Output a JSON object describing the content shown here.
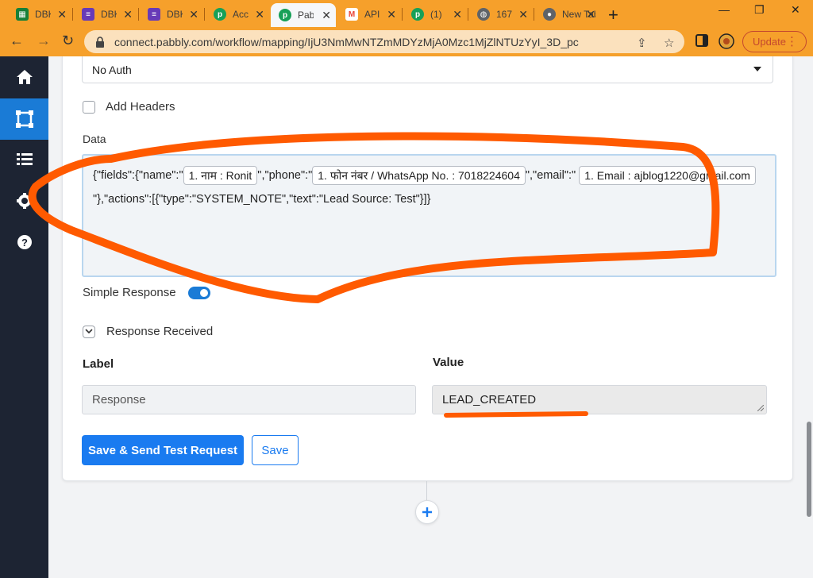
{
  "browser": {
    "tabs": [
      {
        "label": "DBK",
        "icon": "sheets-icon",
        "color": "#188038"
      },
      {
        "label": "DBK",
        "icon": "forms-icon",
        "color": "#673ab7"
      },
      {
        "label": "DBK",
        "icon": "forms-icon",
        "color": "#673ab7"
      },
      {
        "label": "Acc",
        "icon": "pabbly-icon",
        "color": "#17a058"
      },
      {
        "label": "Pab",
        "icon": "pabbly-icon",
        "color": "#17a058"
      },
      {
        "label": "API",
        "icon": "gmail-icon",
        "color": "#ea4335"
      },
      {
        "label": "(1)",
        "icon": "pabbly-icon",
        "color": "#17a058"
      },
      {
        "label": "167",
        "icon": "globe-icon",
        "color": "#5f6368"
      },
      {
        "label": "New Tab",
        "icon": "chrome-icon",
        "color": "#5f6368"
      }
    ],
    "url": "connect.pabbly.com/workflow/mapping/IjU3NmMwNTZmMDYzMjA0Mzc1MjZlNTUzYyI_3D_pc",
    "update_label": "Update"
  },
  "form": {
    "auth_value": "No Auth",
    "add_headers_label": "Add Headers",
    "data_label": "Data",
    "data": {
      "part1": "{\"fields\":{\"name\":\"",
      "pill_name": "1. नाम : Ronit",
      "part2": "\",\"phone\":\"",
      "pill_phone": "1. फोन नंबर / WhatsApp No. : 7018224604",
      "part3": "\",\"email\":\"",
      "pill_email": "1. Email : ajblog1220@gmail.com",
      "part4": "\"},\"actions\":[{\"type\":\"SYSTEM_NOTE\",\"text\":\"Lead Source: Test\"}]}"
    },
    "simple_response_label": "Simple Response",
    "simple_response_on": true,
    "response_received_label": "Response Received",
    "label_header": "Label",
    "value_header": "Value",
    "response_label_value": "Response",
    "response_value": "LEAD_CREATED",
    "save_send_label": "Save & Send Test Request",
    "save_label": "Save"
  },
  "colors": {
    "accent": "#1a7bf0",
    "sidebar": "#1d2433",
    "annotation": "#ff5a00"
  }
}
